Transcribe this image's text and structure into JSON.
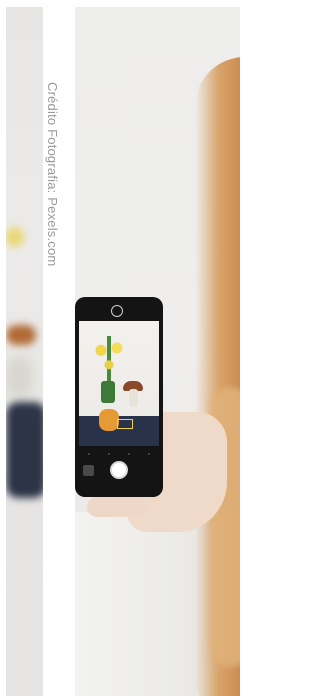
{
  "credit": {
    "text": "Crédito Fotografia: Pexels.com"
  },
  "colors": {
    "background": "#ffffff",
    "credit_text": "#9a9a9a",
    "hair": "#c98a4d",
    "phone_body": "#141414",
    "flowers": "#f1d64a",
    "tablecloth": "#283349"
  },
  "image": {
    "subject": "woman photographing flowers with a smartphone"
  }
}
